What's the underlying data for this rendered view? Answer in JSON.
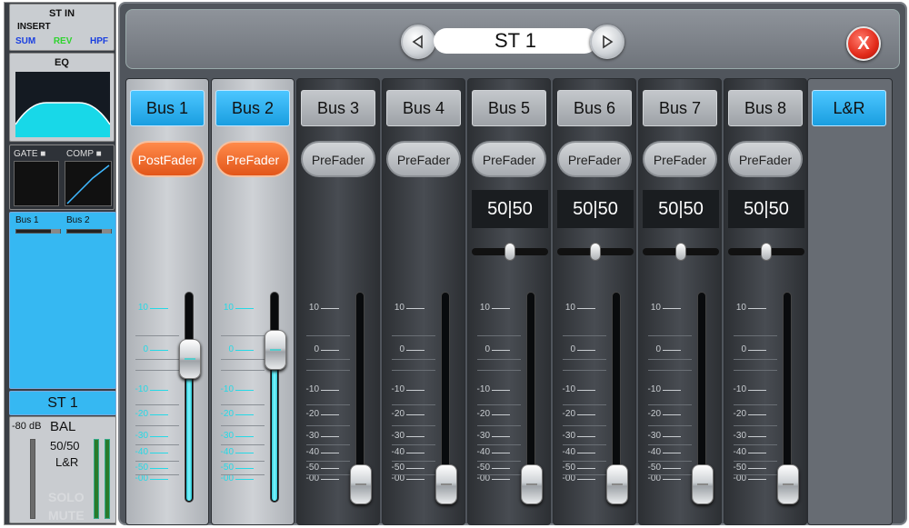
{
  "left_panel": {
    "st_in": {
      "title": "ST IN",
      "insert": "INSERT",
      "sum": "SUM",
      "rev": "REV",
      "hpf": "HPF",
      "colors": {
        "sum": "#1a3fe0",
        "rev": "#2fd42f",
        "hpf": "#1a3fe0"
      }
    },
    "eq": {
      "title": "EQ"
    },
    "dynamics": {
      "gate": "GATE ■",
      "comp": "COMP ■"
    },
    "bus_sends": {
      "bus1": "Bus 1",
      "bus2": "Bus 2"
    },
    "channel_name": "ST 1",
    "meter": {
      "db": "-80 dB",
      "bal": "BAL",
      "pan": "50/50",
      "assign": "L&R",
      "solo": "SOLO",
      "mute": "MUTE"
    }
  },
  "header": {
    "title": "ST 1",
    "prev_icon": "triangle-left-icon",
    "next_icon": "triangle-right-icon",
    "close_label": "X"
  },
  "accent": {
    "active_blue": "#1a9ee0",
    "tap_orange": "#e2561a",
    "fader_fill": "#2fc9d6"
  },
  "scale_labels": [
    "10",
    "0",
    "-10",
    "-20",
    "-30",
    "-40",
    "-50",
    "-00"
  ],
  "strips": [
    {
      "bus": "Bus 1",
      "tap": "PostFader",
      "active": true,
      "pan": null,
      "fader_db": 0
    },
    {
      "bus": "Bus 2",
      "tap": "PreFader",
      "active": true,
      "pan": null,
      "fader_db": 2
    },
    {
      "bus": "Bus 3",
      "tap": "PreFader",
      "active": false,
      "pan": null,
      "fader_db": -100
    },
    {
      "bus": "Bus 4",
      "tap": "PreFader",
      "active": false,
      "pan": null,
      "fader_db": -100
    },
    {
      "bus": "Bus 5",
      "tap": "PreFader",
      "active": false,
      "pan": "50|50",
      "fader_db": -100
    },
    {
      "bus": "Bus 6",
      "tap": "PreFader",
      "active": false,
      "pan": "50|50",
      "fader_db": -100
    },
    {
      "bus": "Bus 7",
      "tap": "PreFader",
      "active": false,
      "pan": "50|50",
      "fader_db": -100
    },
    {
      "bus": "Bus 8",
      "tap": "PreFader",
      "active": false,
      "pan": "50|50",
      "fader_db": -100
    }
  ],
  "lr": {
    "label": "L&R"
  }
}
